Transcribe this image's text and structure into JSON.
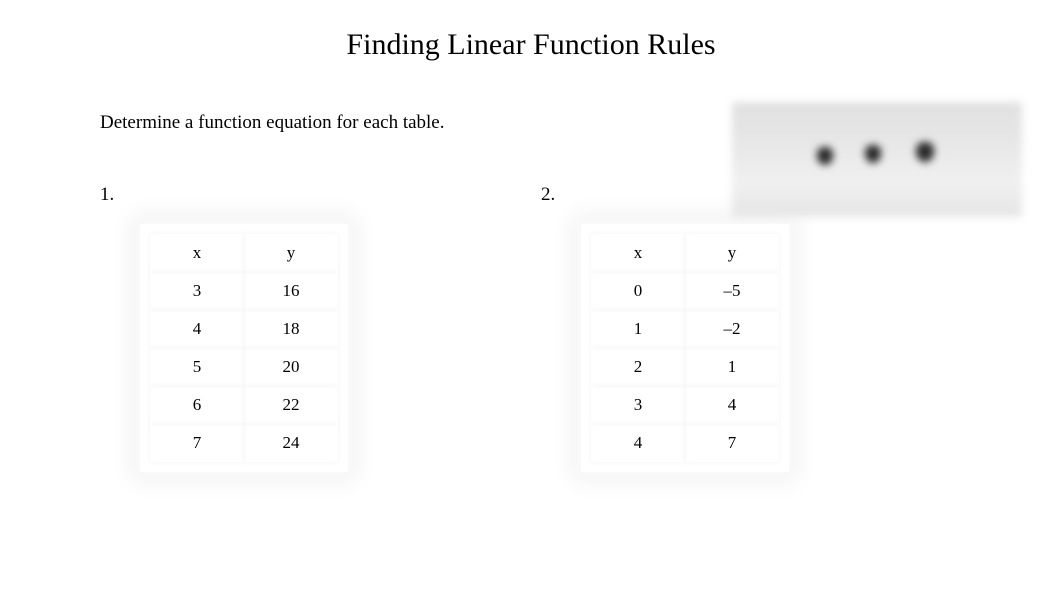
{
  "title": "Finding Linear Function Rules",
  "instruction": "Determine a function equation for each table.",
  "problems": [
    {
      "number": "1.",
      "headers": {
        "x": "x",
        "y": "y"
      },
      "rows": [
        {
          "x": "3",
          "y": "16"
        },
        {
          "x": "4",
          "y": "18"
        },
        {
          "x": "5",
          "y": "20"
        },
        {
          "x": "6",
          "y": "22"
        },
        {
          "x": "7",
          "y": "24"
        }
      ]
    },
    {
      "number": "2.",
      "headers": {
        "x": "x",
        "y": "y"
      },
      "rows": [
        {
          "x": "0",
          "y": "–5"
        },
        {
          "x": "1",
          "y": "–2"
        },
        {
          "x": "2",
          "y": "1"
        },
        {
          "x": "3",
          "y": "4"
        },
        {
          "x": "4",
          "y": "7"
        }
      ]
    }
  ]
}
